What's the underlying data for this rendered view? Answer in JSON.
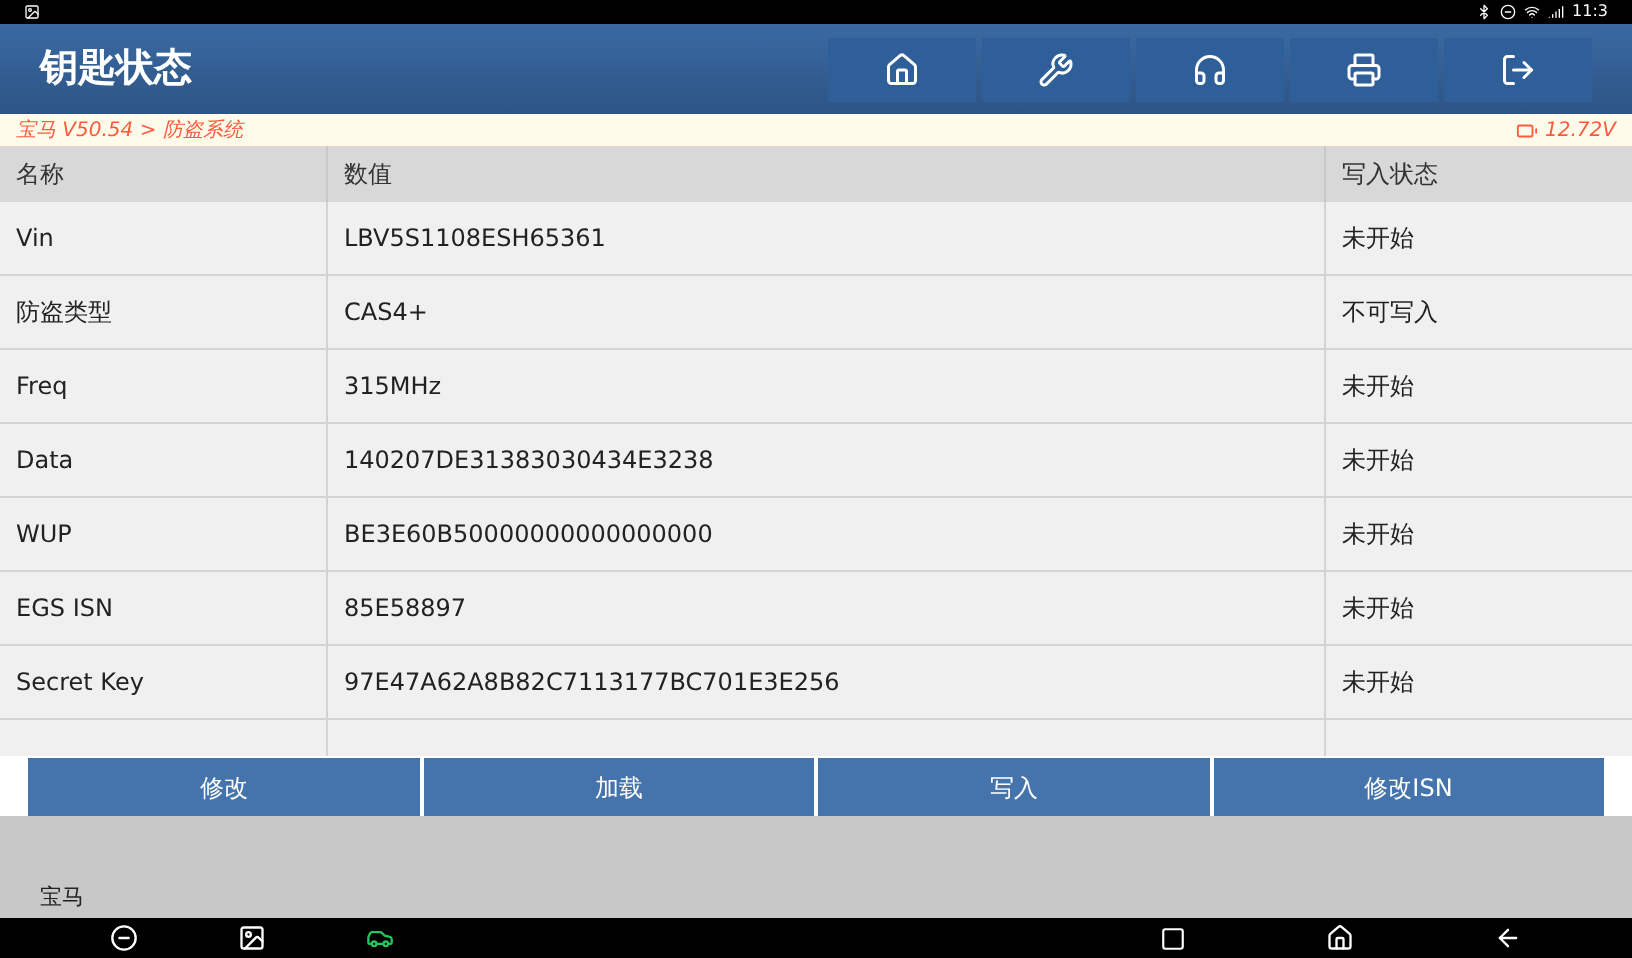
{
  "status_bar": {
    "time": "11:3"
  },
  "header": {
    "title": "钥匙状态"
  },
  "breadcrumb": "宝马 V50.54 > 防盗系统",
  "voltage": "12.72V",
  "table": {
    "columns": [
      "名称",
      "数值",
      "写入状态"
    ],
    "rows": [
      {
        "name": "Vin",
        "value": "LBV5S1108ESH65361",
        "status": "未开始"
      },
      {
        "name": "防盗类型",
        "value": "CAS4+",
        "status": "不可写入"
      },
      {
        "name": "Freq",
        "value": "315MHz",
        "status": "未开始"
      },
      {
        "name": "Data",
        "value": "140207DE31383030434E3238",
        "status": "未开始"
      },
      {
        "name": "WUP",
        "value": "BE3E60B50000000000000000",
        "status": "未开始"
      },
      {
        "name": "EGS ISN",
        "value": "85E58897",
        "status": "未开始"
      },
      {
        "name": "Secret Key",
        "value": "97E47A62A8B82C7113177BC701E3E256",
        "status": "未开始"
      }
    ]
  },
  "actions": [
    "修改",
    "加载",
    "写入",
    "修改ISN"
  ],
  "footer": "宝马"
}
